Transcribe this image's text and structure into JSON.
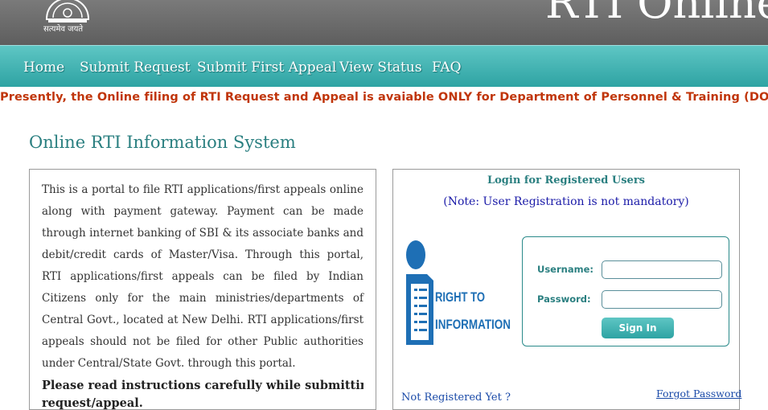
{
  "header": {
    "motto": "सत्यमेव जयते",
    "site_title": "RTI Online"
  },
  "nav": {
    "items": [
      {
        "label": "Home"
      },
      {
        "label": "Submit Request"
      },
      {
        "label": "Submit First Appeal"
      },
      {
        "label": "View Status"
      },
      {
        "label": "FAQ"
      }
    ]
  },
  "notice": "Presently, the Online filing of RTI Request and Appeal is avaiable ONLY for Department of Personnel & Training (DOPT).",
  "page_title": "Online RTI Information System",
  "info": {
    "text": "This is a portal to file RTI applications/first appeals online along with payment gateway. Payment can be made through internet banking of SBI & its associate banks and debit/credit cards of Master/Visa. Through this portal, RTI applications/first appeals can be filed by Indian Citizens only for the main ministries/departments of Central Govt., located at New Delhi. RTI applications/first appeals should not be filed for other Public authorities under Central/State Govt. through this portal.",
    "bold_line1": "Please read instructions carefully while submitting",
    "bold_line2": "request/appeal."
  },
  "login": {
    "title": "Login for Registered Users",
    "note": "(Note: User Registration is not mandatory)",
    "logo_line1": "RIGHT TO",
    "logo_line2": "INFORMATION",
    "username_label": "Username:",
    "username_value": "",
    "password_label": "Password:",
    "password_value": "",
    "signin_label": "Sign In",
    "forgot_label": "Forgot Password",
    "not_registered_label": "Not Registered Yet ?"
  },
  "colors": {
    "nav_teal": "#2ea3a3",
    "header_gray": "#6a6a6a",
    "notice_red": "#c0350a",
    "title_teal": "#2a7f80",
    "link_blue": "#1a4aa8",
    "logo_blue": "#1e6fb5"
  }
}
